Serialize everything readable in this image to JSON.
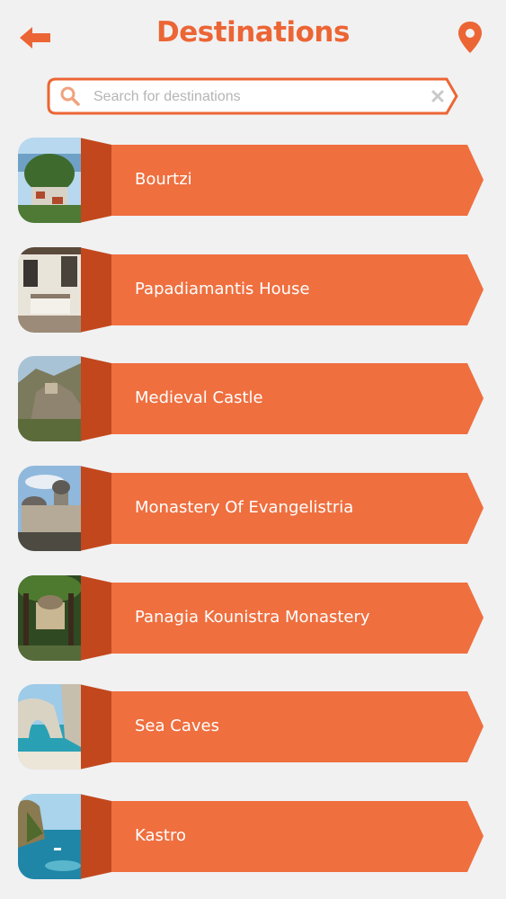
{
  "header": {
    "title": "Destinations",
    "back_icon": "back-arrow-icon",
    "location_icon": "map-pin-icon"
  },
  "search": {
    "placeholder": "Search for destinations",
    "value": "",
    "search_icon": "magnifier-icon",
    "clear_icon": "clear-x-icon"
  },
  "colors": {
    "accent": "#ec6535",
    "banner": "#ef6f3f",
    "fold": "#c3471d",
    "background": "#f1f1f1"
  },
  "destinations": [
    {
      "label": "Bourtzi"
    },
    {
      "label": "Papadiamantis House"
    },
    {
      "label": "Medieval Castle"
    },
    {
      "label": "Monastery Of Evangelistria"
    },
    {
      "label": "Panagia Kounistra Monastery"
    },
    {
      "label": "Sea Caves"
    },
    {
      "label": "Kastro"
    }
  ]
}
